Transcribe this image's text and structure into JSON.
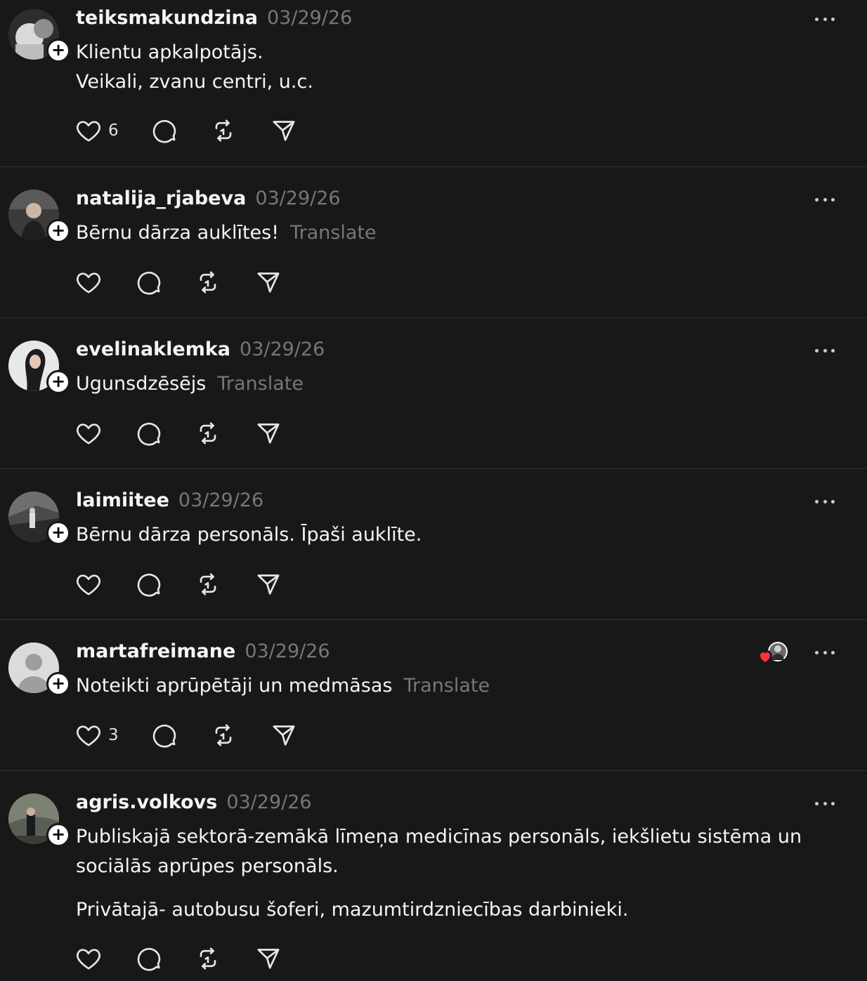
{
  "posts": [
    {
      "username": "teiksmakundzina",
      "timestamp": "03/29/26",
      "lines": [
        "Klientu apkalpotājs.",
        "Veikali, zvanu centri, u.c."
      ],
      "translate": "",
      "like_count": "6"
    },
    {
      "username": "natalija_rjabeva",
      "timestamp": "03/29/26",
      "lines": [
        "Bērnu dārza auklītes!"
      ],
      "translate": "Translate",
      "like_count": ""
    },
    {
      "username": "evelinaklemka",
      "timestamp": "03/29/26",
      "lines": [
        "Ugunsdzēsējs"
      ],
      "translate": "Translate",
      "like_count": ""
    },
    {
      "username": "laimiitee",
      "timestamp": "03/29/26",
      "lines": [
        "Bērnu dārza personāls. Īpaši auklīte."
      ],
      "translate": "",
      "like_count": ""
    },
    {
      "username": "martafreimane",
      "timestamp": "03/29/26",
      "lines": [
        "Noteikti aprūpētāji un medmāsas"
      ],
      "translate": "Translate",
      "like_count": "3"
    },
    {
      "username": "agris.volkovs",
      "timestamp": "03/29/26",
      "lines": [
        "Publiskajā sektorā-zemākā līmeņa medicīnas personāls, iekšlietu sistēma un",
        "sociālās aprūpes personāls.",
        "Privātajā- autobusu šoferi, mazumtirdzniecības darbinieki."
      ],
      "translate": "",
      "like_count": ""
    }
  ],
  "icons": {
    "like": "heart-icon",
    "reply": "comment-icon",
    "repost": "repost-icon",
    "share": "send-icon",
    "more": "more-icon",
    "follow": "plus-icon"
  },
  "colors": {
    "background": "#181818",
    "text": "#f3f5f7",
    "muted": "#777777",
    "divider": "#323232",
    "heart_badge": "#ff3040"
  }
}
